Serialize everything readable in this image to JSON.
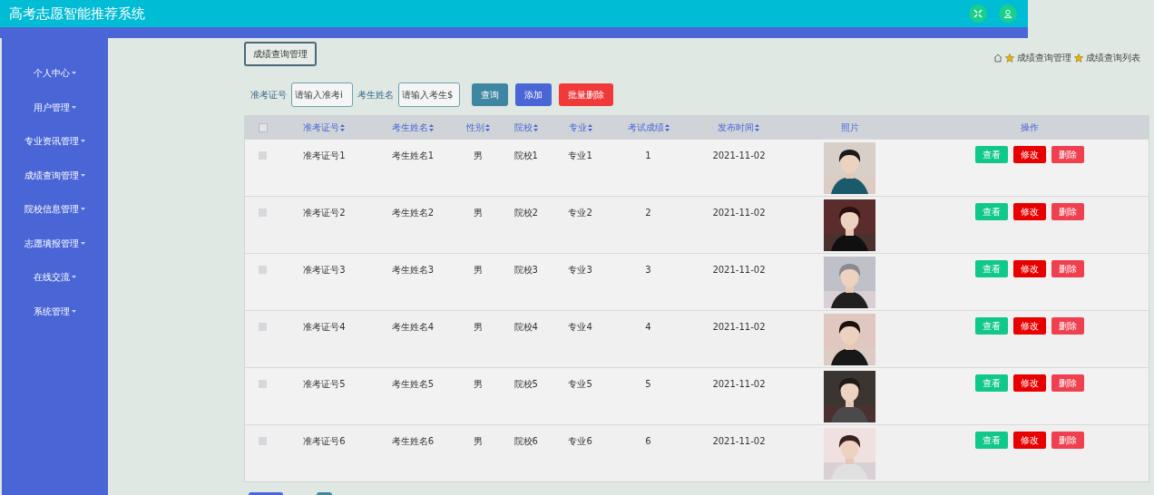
{
  "header": {
    "title": "高考志愿智能推荐系统"
  },
  "sidebar": {
    "items": [
      {
        "label": "个人中心"
      },
      {
        "label": "用户管理"
      },
      {
        "label": "专业资讯管理"
      },
      {
        "label": "成绩查询管理"
      },
      {
        "label": "院校信息管理"
      },
      {
        "label": "志愿填报管理"
      },
      {
        "label": "在线交流"
      },
      {
        "label": "系统管理"
      }
    ]
  },
  "page_tab": "成绩查询管理",
  "breadcrumb": [
    "成绩查询管理",
    "成绩查询列表"
  ],
  "search": {
    "fields": [
      {
        "label": "准考证号",
        "placeholder": "请输入准考i"
      },
      {
        "label": "考生姓名",
        "placeholder": "请输入考生$"
      }
    ],
    "buttons": [
      {
        "label": "查询",
        "kind": "query"
      },
      {
        "label": "添加",
        "kind": "add"
      },
      {
        "label": "批量删除",
        "kind": "delete"
      }
    ]
  },
  "table": {
    "all_checked": false,
    "columns": [
      "准考证号",
      "考生姓名",
      "性别",
      "院校",
      "专业",
      "考试成绩",
      "发布时间",
      "照片",
      "操作"
    ],
    "rows": [
      {
        "checked": false,
        "cells": [
          "准考证号1",
          "考生姓名1",
          "男",
          "院校1",
          "专业1",
          "1",
          "2021-11-02"
        ],
        "photo": {
          "kind": "picture"
        },
        "actions": [
          "查看",
          "修改",
          "删除"
        ]
      },
      {
        "checked": false,
        "cells": [
          "准考证号2",
          "考生姓名2",
          "男",
          "院校2",
          "专业2",
          "2",
          "2021-11-02"
        ],
        "photo": {
          "kind": "picture"
        },
        "actions": [
          "查看",
          "修改",
          "删除"
        ]
      },
      {
        "checked": false,
        "cells": [
          "准考证号3",
          "考生姓名3",
          "男",
          "院校3",
          "专业3",
          "3",
          "2021-11-02"
        ],
        "photo": {
          "kind": "picture"
        },
        "actions": [
          "查看",
          "修改",
          "删除"
        ]
      },
      {
        "checked": false,
        "cells": [
          "准考证号4",
          "考生姓名4",
          "男",
          "院校4",
          "专业4",
          "4",
          "2021-11-02"
        ],
        "photo": {
          "kind": "picture"
        },
        "actions": [
          "查看",
          "修改",
          "删除"
        ]
      },
      {
        "checked": false,
        "cells": [
          "准考证号5",
          "考生姓名5",
          "男",
          "院校5",
          "专业5",
          "5",
          "2021-11-02"
        ],
        "photo": {
          "kind": "picture"
        },
        "actions": [
          "查看",
          "修改",
          "删除"
        ]
      },
      {
        "checked": false,
        "cells": [
          "准考证号6",
          "考生姓名6",
          "男",
          "院校6",
          "专业6",
          "6",
          "2021-11-02"
        ],
        "photo": {
          "kind": "picture"
        },
        "actions": [
          "查看",
          "修改",
          "删除"
        ]
      }
    ]
  }
}
